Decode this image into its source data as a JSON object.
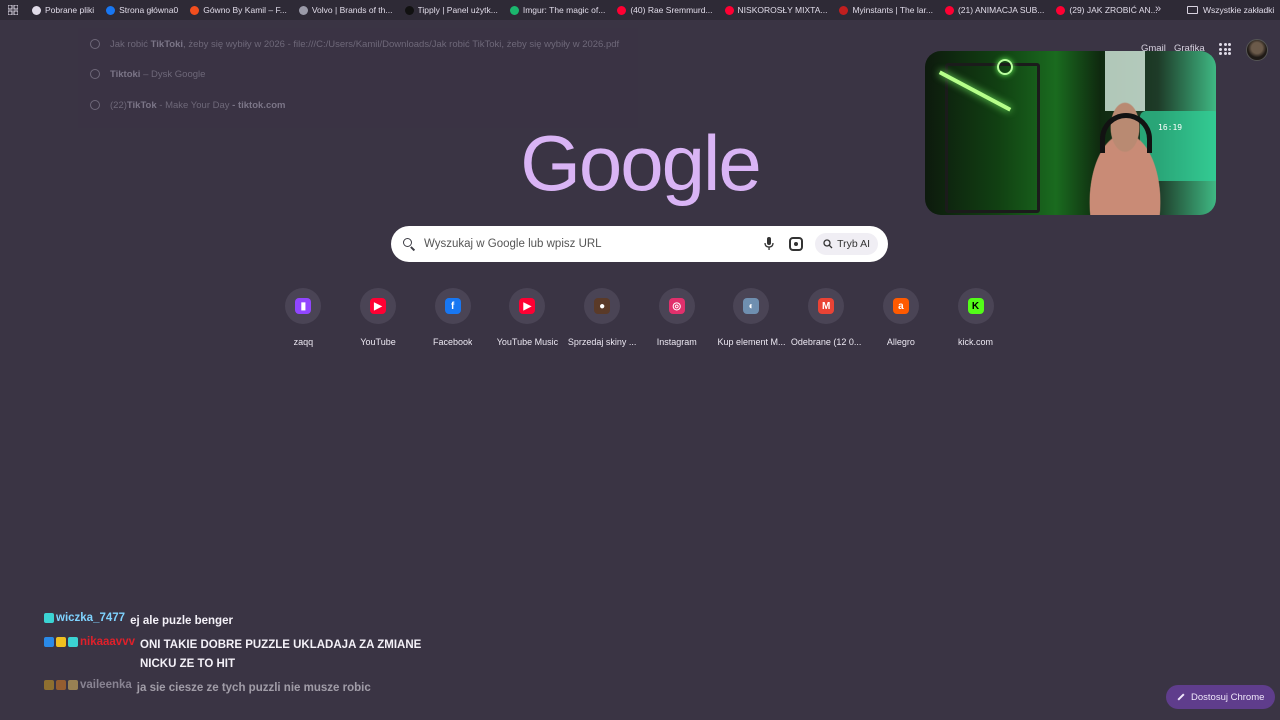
{
  "bookmarks": [
    {
      "label": "Pobrane pliki",
      "icon": "download-icon",
      "color": "#e0dbe8"
    },
    {
      "label": "Strona główna0",
      "icon": "facebook-icon",
      "color": "#1877f2"
    },
    {
      "label": "Gówno By Kamil – F...",
      "icon": "figma-icon",
      "color": "#f24e1e"
    },
    {
      "label": "Volvo | Brands of th...",
      "icon": "globe-icon",
      "color": "#9a9aa8"
    },
    {
      "label": "Tipply | Panel użytk...",
      "icon": "tipply-icon",
      "color": "#111111"
    },
    {
      "label": "Imgur: The magic of...",
      "icon": "imgur-icon",
      "color": "#1bb76e"
    },
    {
      "label": "(40) Rae Sremmurd...",
      "icon": "youtube-icon",
      "color": "#ff0033"
    },
    {
      "label": "NISKOROSŁY MIXTA...",
      "icon": "youtube-icon",
      "color": "#ff0033"
    },
    {
      "label": "Myinstants | The lar...",
      "icon": "myinstants-icon",
      "color": "#c21f1f"
    },
    {
      "label": "(21) ANIMACJA SUB...",
      "icon": "youtube-icon",
      "color": "#ff0033"
    },
    {
      "label": "(29) JAK ZROBIĆ AN...",
      "icon": "youtube-icon",
      "color": "#ff0033"
    }
  ],
  "bookmarks_more": "»",
  "all_bookmarks": "Wszystkie zakładki",
  "suggestions": [
    {
      "pre": "Jak robić ",
      "bold": "TikToki",
      "post": ", żeby się wybiły w 2026",
      "url": " - file:///C:/Users/Kamil/Downloads/Jak robić TikToki, żeby się wybiły w 2026.pdf"
    },
    {
      "pre": "",
      "bold": "Tiktoki",
      "post": " – Dysk Google",
      "url": ""
    },
    {
      "pre": "(22)",
      "bold": "TikTok",
      "post": " - Make Your Day",
      "url": " - tiktok.com"
    }
  ],
  "header": {
    "gmail": "Gmail",
    "images": "Grafika"
  },
  "webcam": {
    "clock": "16:19"
  },
  "logo": "Google",
  "logo_color": "#d9b4f5",
  "search": {
    "placeholder": "Wyszukaj w Google lub wpisz URL",
    "ai_label": "Tryb AI"
  },
  "shortcuts": [
    {
      "label": "zaqq",
      "glyph": "▮",
      "color": "#9146ff",
      "icon": "twitch-icon"
    },
    {
      "label": "YouTube",
      "glyph": "▶",
      "color": "#ff0033",
      "icon": "youtube-icon"
    },
    {
      "label": "Facebook",
      "glyph": "f",
      "color": "#1877f2",
      "icon": "facebook-icon"
    },
    {
      "label": "YouTube Music",
      "glyph": "▶",
      "color": "#ff0033",
      "icon": "youtube-music-icon"
    },
    {
      "label": "Sprzedaj skiny ...",
      "glyph": "●",
      "color": "#5a3a28",
      "icon": "skins-shop-icon"
    },
    {
      "label": "Instagram",
      "glyph": "◎",
      "color": "#e1306c",
      "icon": "instagram-icon"
    },
    {
      "label": "Kup element M...",
      "glyph": "◐",
      "color": "#6f8fb0",
      "icon": "kup-element-icon"
    },
    {
      "label": "Odebrane (12 0...",
      "glyph": "M",
      "color": "#ea4335",
      "icon": "gmail-icon"
    },
    {
      "label": "Allegro",
      "glyph": "a",
      "color": "#ff5a00",
      "icon": "allegro-icon"
    },
    {
      "label": "kick.com",
      "glyph": "K",
      "color": "#53fc18",
      "icon": "kick-icon"
    }
  ],
  "chat": [
    {
      "user": "wiczka_7477",
      "user_color": "#7fd3ff",
      "message": "ej ale puzle benger",
      "badges": [
        "#3bd3d3"
      ],
      "dim": false
    },
    {
      "user": "nikaaavvv",
      "user_color": "#e0202a",
      "message": "ONI TAKIE DOBRE PUZZLE UKLADAJA ZA ZMIANE NICKU ZE TO HIT",
      "badges": [
        "#2a8ae8",
        "#f0c020",
        "#3bd3d3"
      ],
      "dim": false
    },
    {
      "user": "vaileenka",
      "user_color": "#c9c4d2",
      "message": "ja sie ciesze ze tych puzzli nie musze robic",
      "badges": [
        "#d4a020",
        "#e08020",
        "#e6c060"
      ],
      "dim": true
    }
  ],
  "customize_label": "Dostosuj Chrome"
}
